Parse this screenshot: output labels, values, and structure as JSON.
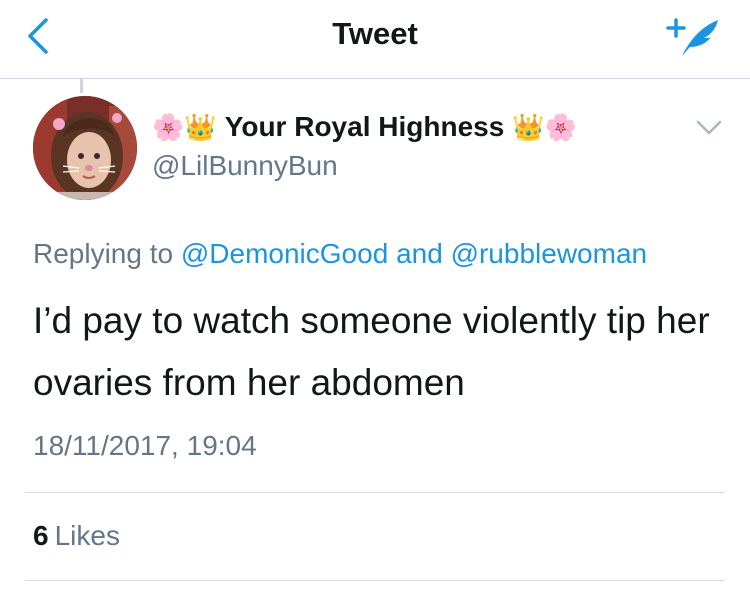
{
  "nav": {
    "title": "Tweet",
    "back_icon": "chevron-left-icon",
    "compose_icon": "compose-tweet-icon"
  },
  "tweet": {
    "display_name": "Your Royal Highness",
    "name_emojis": [
      "🌸",
      "👑",
      "👑",
      "🌸"
    ],
    "handle": "@LilBunnyBun",
    "replying_prefix": "Replying to",
    "reply_mentions": [
      "@DemonicGood",
      "@rubblewoman"
    ],
    "reply_joiner": "and",
    "text": "I’d pay to watch someone violently tip her ovaries from her abdomen",
    "timestamp": "18/11/2017, 19:04",
    "likes_count": "6",
    "likes_label": "Likes"
  },
  "colors": {
    "accent": "#1b95e0",
    "secondary_text": "#657786",
    "primary_text": "#14171a",
    "divider": "#d5dce2"
  }
}
